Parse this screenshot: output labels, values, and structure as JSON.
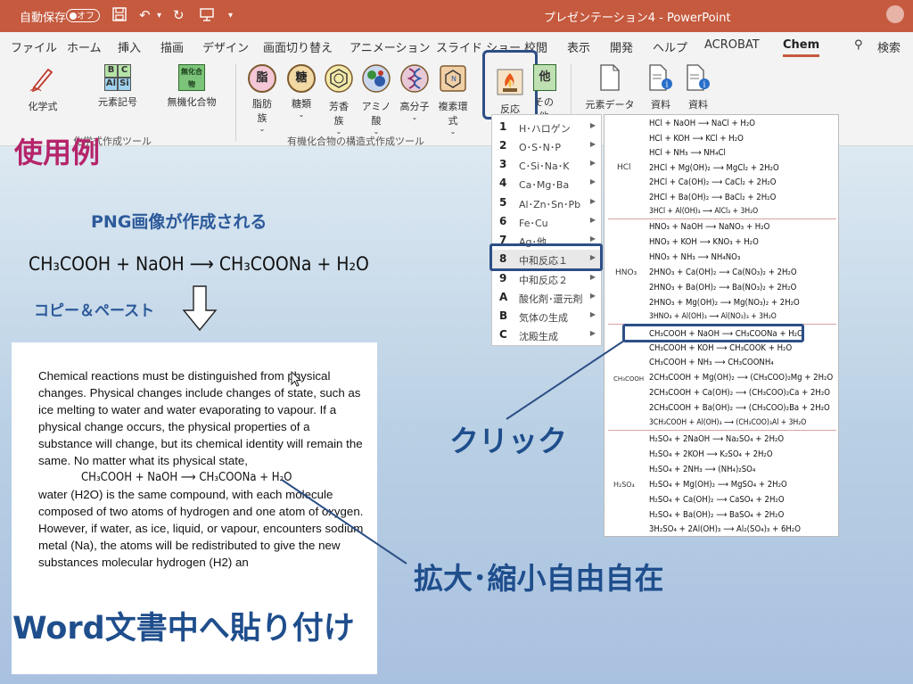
{
  "titlebar": {
    "autosave_label": "自動保存",
    "autosave_state": "オフ",
    "title": "プレゼンテーション4  -  PowerPoint"
  },
  "tabs": [
    {
      "label": "ファイル"
    },
    {
      "label": "ホーム"
    },
    {
      "label": "挿入"
    },
    {
      "label": "描画"
    },
    {
      "label": "デザイン"
    },
    {
      "label": "画面切り替え"
    },
    {
      "label": "アニメーション"
    },
    {
      "label": "スライド ショー"
    },
    {
      "label": "校閲"
    },
    {
      "label": "表示"
    },
    {
      "label": "開発"
    },
    {
      "label": "ヘルプ"
    },
    {
      "label": "ACROBAT"
    },
    {
      "label": "Chem"
    }
  ],
  "search_label": "検索",
  "ribbon": {
    "btn_chem_formula": "化学式",
    "btn_element_symbol": "元素記号",
    "element_tiles": [
      "B",
      "C",
      "Al",
      "Si"
    ],
    "btn_inorganic": "無機化合物",
    "inorganic_icon_text": "無化合物",
    "btn_fatty": "脂肪族",
    "fatty_icon": "脂",
    "btn_sugar": "糖類",
    "sugar_icon": "糖",
    "btn_aromatic": "芳香族",
    "btn_amino": "アミノ酸",
    "btn_polymer": "高分子",
    "btn_heterocycle": "複素環式",
    "btn_reaction": "反応",
    "btn_other": "その他",
    "other_icon": "他",
    "btn_element_data": "元素データ",
    "btn_material1": "資料",
    "btn_material2": "資料",
    "group1_label": "化学式作成ツール",
    "group2_label": "有機化合物の構造式作成ツール"
  },
  "slide": {
    "usage_title": "使用例",
    "png_note": "PNG画像が作成される",
    "equation": "CH₃COOH + NaOH ⟶ CH₃COONa + H₂O",
    "copy_paste": "コピー＆ペースト",
    "click_label": "クリック",
    "zoom_label": "拡大･縮小自由自在",
    "word_label": "Word文書中へ貼り付け"
  },
  "document": {
    "para1": "Chemical reactions must be distinguished from physical changes. Physical changes include changes of state, such as ice melting to water and water evaporating to vapour. If a physical change occurs, the physical properties of a substance will change, but its chemical identity will remain the same. No matter what its physical state,",
    "equation": "CH₃COOH + NaOH ⟶ CH₃COONa + H₂O",
    "para2": "water (H2O) is the same compound, with each molecule composed of two atoms of hydrogen and one atom of oxygen. However, if water, as ice, liquid, or vapour, encounters sodium metal (Na), the atoms will be redistributed to give the new substances molecular hydrogen (H2) an"
  },
  "menu": [
    {
      "key": "1",
      "label": "H･ハロゲン"
    },
    {
      "key": "2",
      "label": "O･S･N･P"
    },
    {
      "key": "3",
      "label": "C･Si･Na･K"
    },
    {
      "key": "4",
      "label": "Ca･Mg･Ba"
    },
    {
      "key": "5",
      "label": "Al･Zn･Sn･Pb"
    },
    {
      "key": "6",
      "label": "Fe･Cu"
    },
    {
      "key": "7",
      "label": "Ag･他"
    },
    {
      "key": "8",
      "label": "中和反応１"
    },
    {
      "key": "9",
      "label": "中和反応２"
    },
    {
      "key": "A",
      "label": "酸化剤･還元剤"
    },
    {
      "key": "B",
      "label": "気体の生成"
    },
    {
      "key": "C",
      "label": "沈殿生成"
    }
  ],
  "reactions": {
    "hcl_label": "HCl",
    "hcl": [
      "HCl + NaOH ⟶ NaCl + H₂O",
      "HCl + KOH ⟶ KCl + H₂O",
      "HCl + NH₃ ⟶ NH₄Cl",
      "2HCl + Mg(OH)₂ ⟶ MgCl₂ + 2H₂O",
      "2HCl + Ca(OH)₂ ⟶ CaCl₂ + 2H₂O",
      "2HCl + Ba(OH)₂ ⟶ BaCl₂ + 2H₂O",
      "3HCl + Al(OH)₃ ⟶ AlCl₃ + 3H₂O"
    ],
    "hno3_label": "HNO₃",
    "hno3": [
      "HNO₃ + NaOH ⟶ NaNO₃ + H₂O",
      "HNO₃ + KOH ⟶ KNO₃ + H₂O",
      "HNO₃ + NH₃ ⟶ NH₄NO₃",
      "2HNO₃ + Ca(OH)₂ ⟶ Ca(NO₃)₂ + 2H₂O",
      "2HNO₃ + Ba(OH)₂ ⟶ Ba(NO₃)₂ + 2H₂O",
      "2HNO₃ + Mg(OH)₂ ⟶ Mg(NO₃)₂ + 2H₂O",
      "3HNO₃ + Al(OH)₃ ⟶ Al(NO₃)₃ + 3H₂O"
    ],
    "ch3cooh_label": "CH₃COOH",
    "ch3cooh": [
      "CH₃COOH + NaOH ⟶ CH₃COONa + H₂O",
      "CH₃COOH + KOH ⟶ CH₃COOK + H₂O",
      "CH₃COOH + NH₃ ⟶ CH₃COONH₄",
      "2CH₃COOH + Mg(OH)₂ ⟶ (CH₃COO)₂Mg + 2H₂O",
      "2CH₃COOH + Ca(OH)₂ ⟶ (CH₃COO)₂Ca + 2H₂O",
      "2CH₃COOH + Ba(OH)₂ ⟶ (CH₃COO)₂Ba + 2H₂O",
      "3CH₃COOH + Al(OH)₃ ⟶ (CH₃COO)₃Al + 3H₂O"
    ],
    "h2so4_label": "H₂SO₄",
    "h2so4": [
      "H₂SO₄ + 2NaOH ⟶ Na₂SO₄ + 2H₂O",
      "H₂SO₄ + 2KOH ⟶ K₂SO₄ + 2H₂O",
      "H₂SO₄ + 2NH₃ ⟶ (NH₄)₂SO₄",
      "H₂SO₄ + Mg(OH)₂ ⟶ MgSO₄ + 2H₂O",
      "H₂SO₄ + Ca(OH)₂ ⟶ CaSO₄ + 2H₂O",
      "H₂SO₄ + Ba(OH)₂ ⟶ BaSO₄ + 2H₂O",
      "3H₂SO₄ + 2Al(OH)₃ ⟶ Al₂(SO₄)₃ + 6H₂O"
    ]
  },
  "colors": {
    "titlebar": "#c55a3f",
    "accent_blue": "#1f4e8c",
    "usage_title": "#b5246a",
    "highlight_border": "#2d4f85"
  }
}
